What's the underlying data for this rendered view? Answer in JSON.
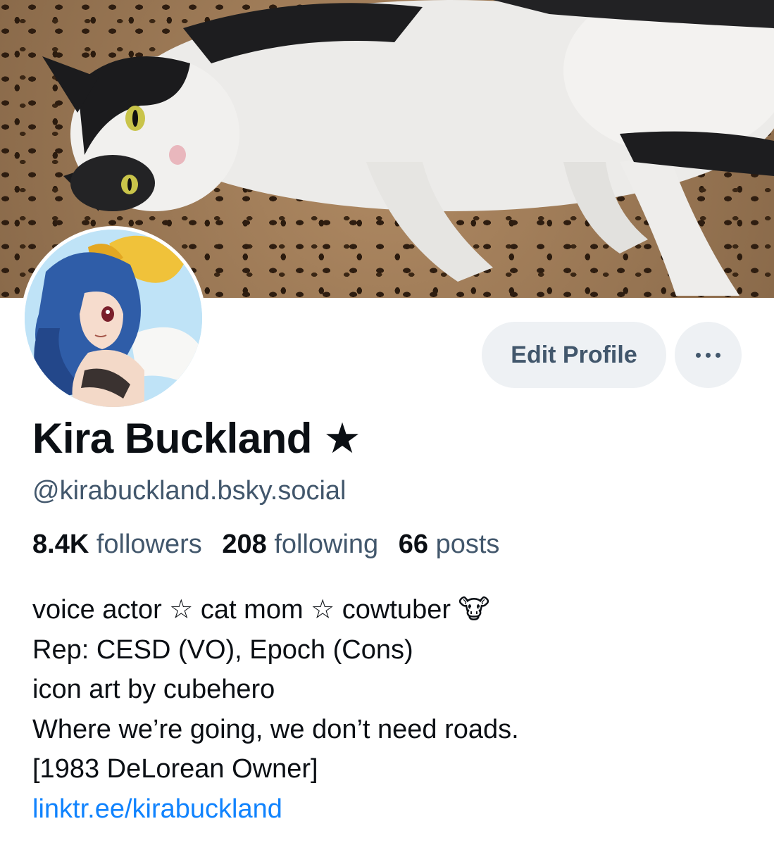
{
  "profile": {
    "display_name": "Kira Buckland ★",
    "handle": "@kirabuckland.bsky.social",
    "banner_icon": "cat-photo",
    "avatar_icon": "anime-character-avatar"
  },
  "actions": {
    "edit_profile_label": "Edit Profile",
    "more_icon": "ellipsis-icon"
  },
  "stats": [
    {
      "value": "8.4K",
      "label": "followers"
    },
    {
      "value": "208",
      "label": "following"
    },
    {
      "value": "66",
      "label": "posts"
    }
  ],
  "bio": {
    "lines": [
      "voice actor ☆ cat mom ☆ cowtuber 🐮",
      "Rep: CESD (VO), Epoch (Cons)",
      "icon art by cubehero",
      "Where we’re going, we don’t need roads.",
      "[1983 DeLorean Owner]"
    ],
    "link_text": "linktr.ee/kirabuckland"
  },
  "colors": {
    "accent_link": "#1083fe",
    "secondary_text": "#42576c",
    "button_bg": "#eef1f4"
  }
}
